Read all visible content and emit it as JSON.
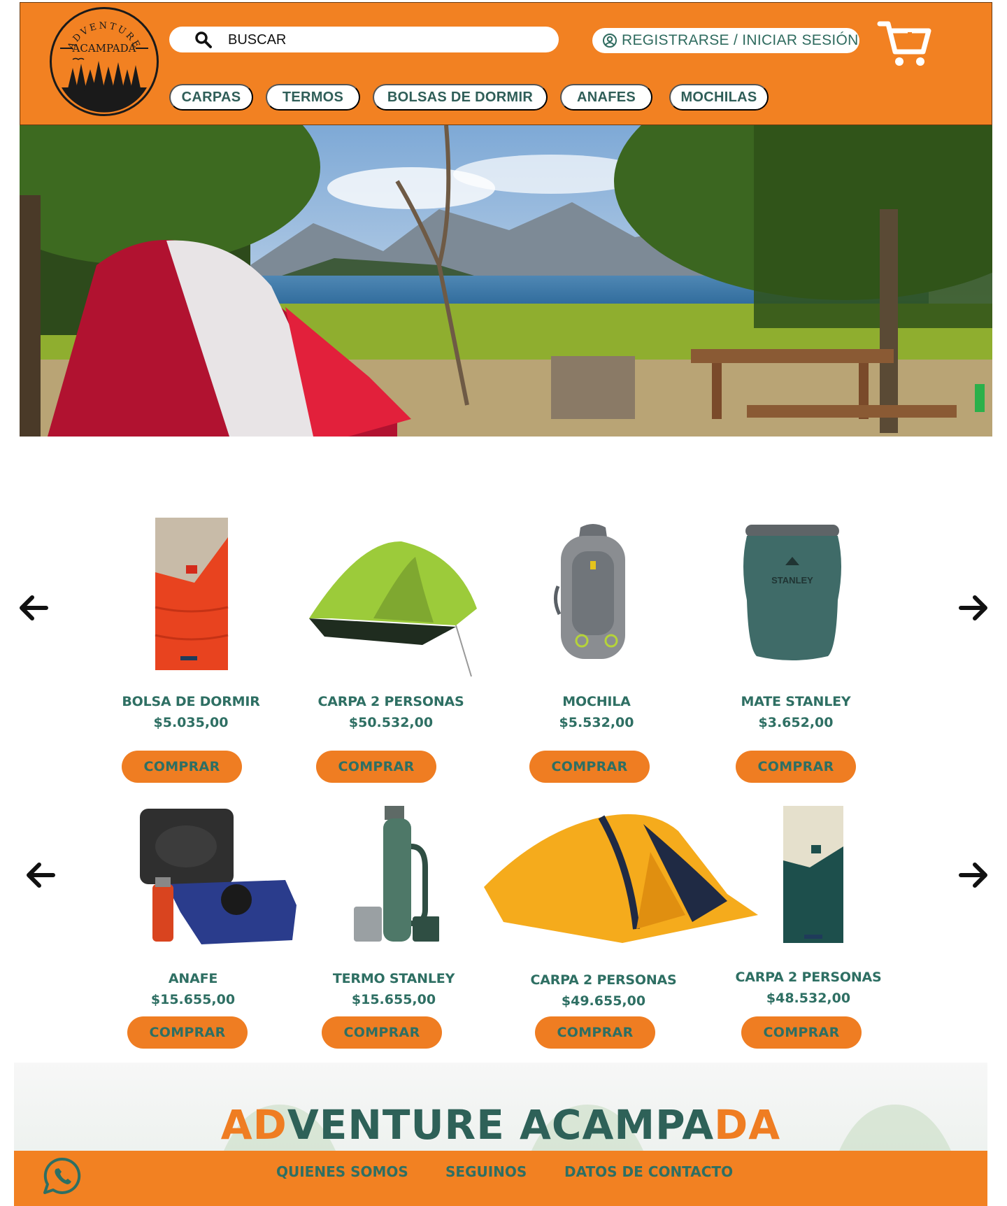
{
  "brand": {
    "arc_text": "ADVENTURE",
    "name": "ACAMPADA"
  },
  "header": {
    "search_placeholder": "BUSCAR",
    "login_label": "REGISTRARSE / INICIAR SESIÓN",
    "nav": [
      "CARPAS",
      "TERMOS",
      "BOLSAS DE DORMIR",
      "ANAFES",
      "MOCHILAS"
    ],
    "colors": {
      "bg": "#f28122",
      "accent": "#2e6f63"
    }
  },
  "products": [
    {
      "items": [
        {
          "name": "BOLSA DE DORMIR",
          "price": "$5.035,00",
          "button": "COMPRAR",
          "icon": "sleeping-bag-red"
        },
        {
          "name": "CARPA 2 PERSONAS",
          "price": "$50.532,00",
          "button": "COMPRAR",
          "icon": "tent-green"
        },
        {
          "name": "MOCHILA",
          "price": "$5.532,00",
          "button": "COMPRAR",
          "icon": "backpack-grey"
        },
        {
          "name": "MATE STANLEY",
          "price": "$3.652,00",
          "button": "COMPRAR",
          "icon": "mate-stanley"
        }
      ]
    },
    {
      "items": [
        {
          "name": "ANAFE",
          "price": "$15.655,00",
          "button": "COMPRAR",
          "icon": "stove-blue"
        },
        {
          "name": "TERMO STANLEY",
          "price": "$15.655,00",
          "button": "COMPRAR",
          "icon": "thermos-green"
        },
        {
          "name": "CARPA 2 PERSONAS",
          "price": "$49.655,00",
          "button": "COMPRAR",
          "icon": "tent-yellow"
        },
        {
          "name": "CARPA 2 PERSONAS",
          "price": "$48.532,00",
          "button": "COMPRAR",
          "icon": "sleeping-bag-teal"
        }
      ]
    }
  ],
  "banner": {
    "title_part1": "AD",
    "title_part2": "VENTURE ACAMPA",
    "title_part3": "DA"
  },
  "footer": {
    "links": [
      "QUIENES SOMOS",
      "SEGUINOS",
      "DATOS DE CONTACTO"
    ]
  }
}
